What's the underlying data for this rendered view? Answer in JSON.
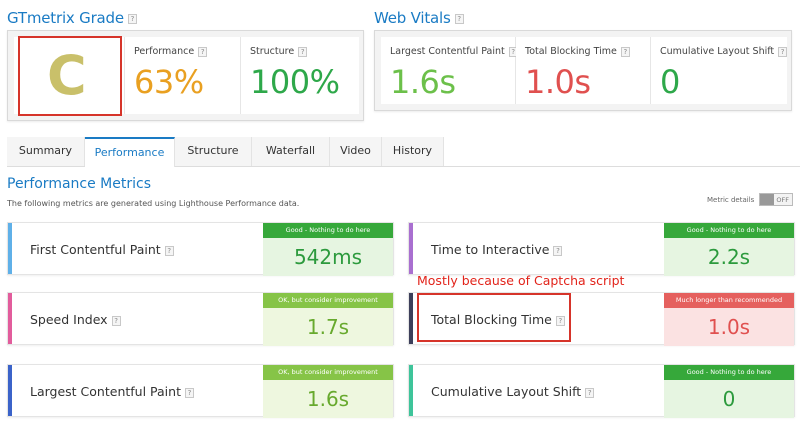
{
  "grade_section": {
    "title": "GTmetrix Grade",
    "grade": "C"
  },
  "web_vitals_section": {
    "title": "Web Vitals"
  },
  "summary_scores": [
    {
      "label": "Performance",
      "value": "63%",
      "color": "#e9a021"
    },
    {
      "label": "Structure",
      "value": "100%",
      "color": "#2ea84a"
    }
  ],
  "web_vitals": [
    {
      "label": "Largest Contentful Paint",
      "value": "1.6s",
      "color": "#6cc04a"
    },
    {
      "label": "Total Blocking Time",
      "value": "1.0s",
      "color": "#e0504f"
    },
    {
      "label": "Cumulative Layout Shift",
      "value": "0",
      "color": "#2ea84a"
    }
  ],
  "tabs": [
    {
      "label": "Summary",
      "active": false
    },
    {
      "label": "Performance",
      "active": true
    },
    {
      "label": "Structure",
      "active": false
    },
    {
      "label": "Waterfall",
      "active": false
    },
    {
      "label": "Video",
      "active": false
    },
    {
      "label": "History",
      "active": false
    }
  ],
  "performance": {
    "title": "Performance Metrics",
    "subtitle": "The following metrics are generated using Lighthouse Performance data.",
    "metric_details_label": "Metric details",
    "toggle_state": "OFF"
  },
  "metrics": [
    {
      "name": "First Contentful Paint",
      "badge": "Good - Nothing to do here",
      "value": "542ms",
      "status": "good",
      "accent": "#5fb0e8"
    },
    {
      "name": "Time to Interactive",
      "badge": "Good - Nothing to do here",
      "value": "2.2s",
      "status": "good",
      "accent": "#a96fd0"
    },
    {
      "name": "Speed Index",
      "badge": "OK, but consider improvement",
      "value": "1.7s",
      "status": "ok",
      "accent": "#e25c9c"
    },
    {
      "name": "Total Blocking Time",
      "badge": "Much longer than recommended",
      "value": "1.0s",
      "status": "bad",
      "accent": "#3c3f5a"
    },
    {
      "name": "Largest Contentful Paint",
      "badge": "OK, but consider improvement",
      "value": "1.6s",
      "status": "ok",
      "accent": "#3b63c9"
    },
    {
      "name": "Cumulative Layout Shift",
      "badge": "Good - Nothing to do here",
      "value": "0",
      "status": "good",
      "accent": "#3ec49a"
    }
  ],
  "annotation": "Mostly because of Captcha script"
}
